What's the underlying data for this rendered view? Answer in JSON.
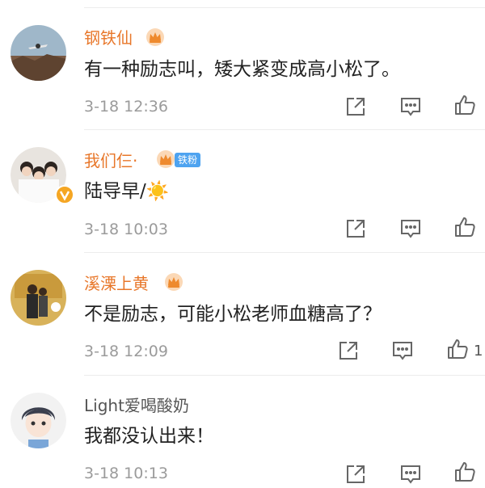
{
  "comments": [
    {
      "username": "钢铁仙",
      "text": "有一种励志叫，矮大紧变成高小松了。",
      "time": "3-18 12:36"
    },
    {
      "username": "我们仨·",
      "fan_badge": "铁粉",
      "text": "陆导早/☀️",
      "time": "3-18 10:03"
    },
    {
      "username": "溪溧上黄",
      "text": "不是励志，可能小松老师血糖高了？",
      "time": "3-18 12:09",
      "like_count": "1"
    },
    {
      "username": "Light爱喝酸奶",
      "text": "我都没认出来！",
      "time": "3-18 10:13"
    }
  ],
  "icons": {
    "share": "share-icon",
    "comment": "comment-icon",
    "like": "thumbs-up-icon"
  },
  "colors": {
    "username": "#e8772a",
    "text": "#222222",
    "time": "#9b9b9b",
    "fan_badge": "#4ea3f0"
  }
}
